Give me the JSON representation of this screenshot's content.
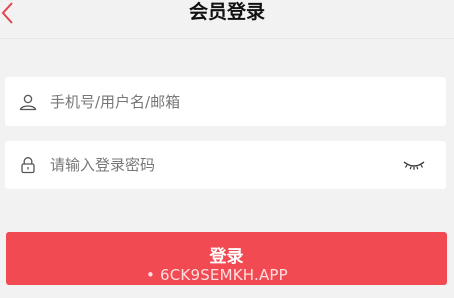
{
  "header": {
    "title": "会员登录",
    "back_icon": "chevron-left-icon"
  },
  "form": {
    "username": {
      "placeholder": "手机号/用户名/邮箱",
      "value": "",
      "icon": "user-icon"
    },
    "password": {
      "placeholder": "请输入登录密码",
      "value": "",
      "icon": "lock-icon",
      "toggle_icon": "eye-closed-icon"
    }
  },
  "login_button": {
    "label": "登录"
  },
  "watermark": {
    "text": "• 6CK9SEMKH.APP"
  },
  "colors": {
    "accent": "#f14a52",
    "background": "#f2f2f2",
    "field_background": "#ffffff"
  }
}
